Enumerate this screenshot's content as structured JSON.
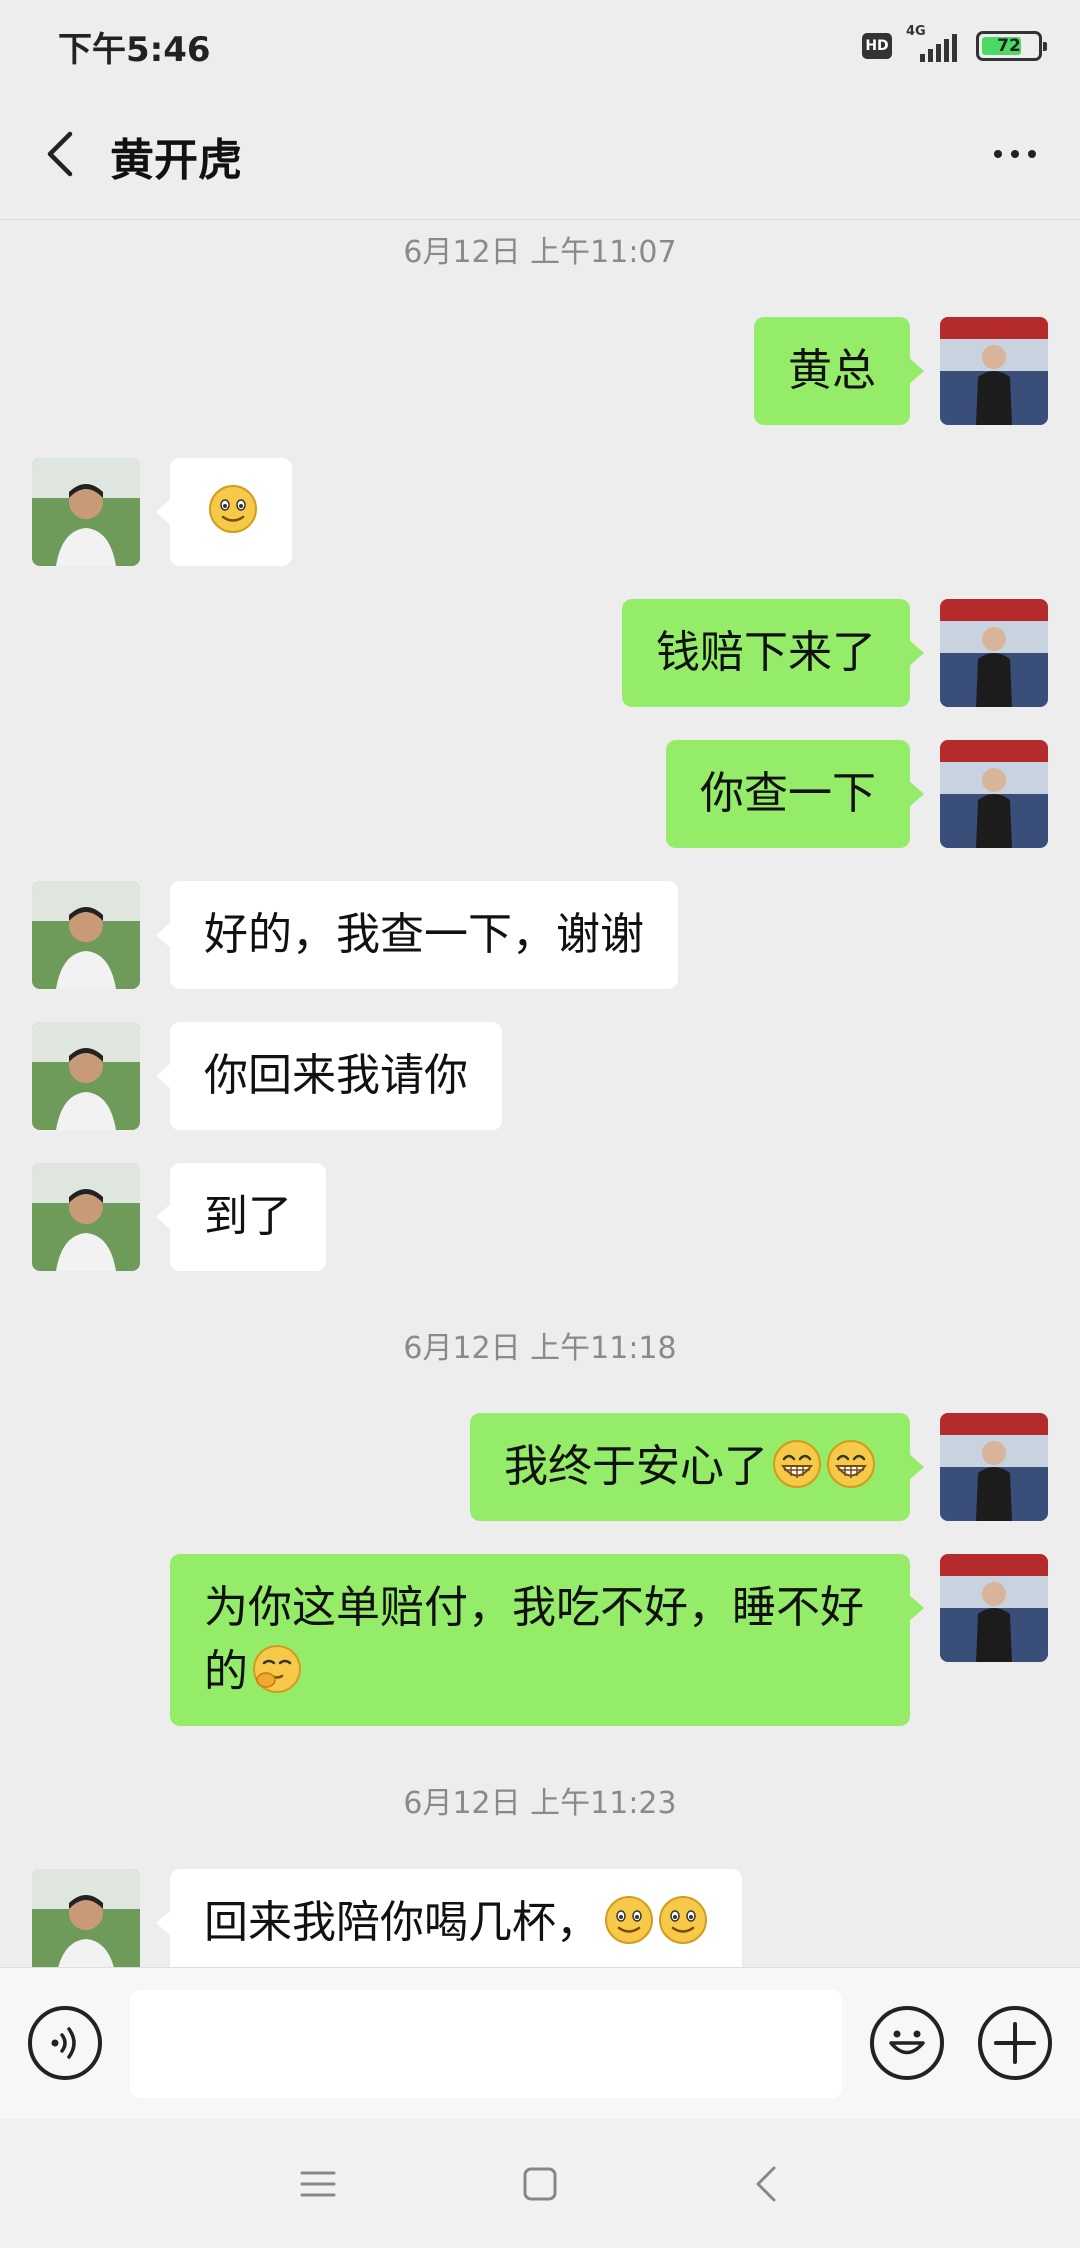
{
  "status_bar": {
    "time": "下午5:46",
    "hd_badge": "HD",
    "network": "4G",
    "battery_level": "72",
    "battery_fraction": 0.72
  },
  "nav": {
    "title": "黄开虎",
    "back_icon": "chevron-left-icon",
    "more_icon": "more-dots-icon"
  },
  "colors": {
    "background": "#ededed",
    "sent_bubble": "#95ec69",
    "received_bubble": "#ffffff",
    "timestamp_text": "#8a8a8a"
  },
  "chat": {
    "timestamps": [
      "6月12日 上午11:07",
      "6月12日 上午11:18",
      "6月12日 上午11:23"
    ],
    "messages": [
      {
        "side": "right",
        "text": "黄总",
        "emojis": []
      },
      {
        "side": "left",
        "text": "",
        "emojis": [
          "smile-emoji"
        ]
      },
      {
        "side": "right",
        "text": "钱赔下来了",
        "emojis": []
      },
      {
        "side": "right",
        "text": "你查一下",
        "emojis": []
      },
      {
        "side": "left",
        "text": "好的，我查一下，谢谢",
        "emojis": []
      },
      {
        "side": "left",
        "text": "你回来我请你",
        "emojis": []
      },
      {
        "side": "left",
        "text": "到了",
        "emojis": []
      },
      {
        "side": "right",
        "text": "我终于安心了",
        "emojis": [
          "grin-emoji",
          "grin-emoji"
        ]
      },
      {
        "side": "right",
        "text": "为你这单赔付，我吃不好，睡不好的",
        "emojis": [
          "shy-emoji"
        ]
      },
      {
        "side": "left",
        "text": "回来我陪你喝几杯，",
        "emojis": [
          "smile-emoji",
          "smile-emoji"
        ]
      }
    ]
  },
  "input_bar": {
    "voice_icon": "voice-icon",
    "input_value": "",
    "emoji_icon": "emoji-icon",
    "plus_icon": "plus-icon"
  },
  "system_nav": {
    "menu_icon": "menu-icon",
    "home_icon": "home-icon",
    "back_icon": "back-icon"
  }
}
